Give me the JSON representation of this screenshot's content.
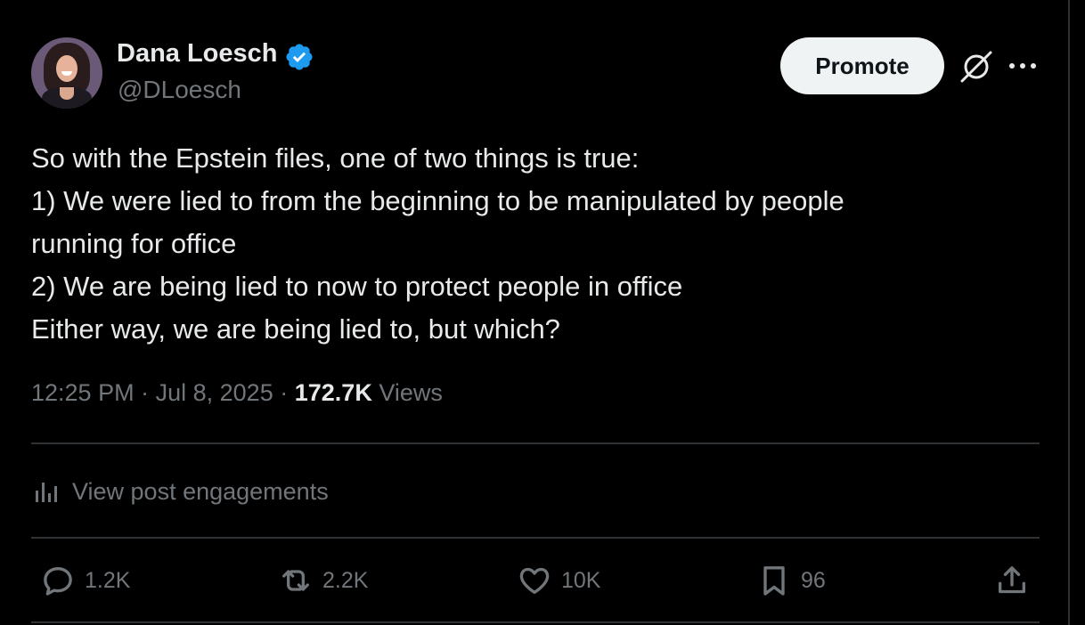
{
  "author": {
    "display_name": "Dana Loesch",
    "handle": "@DLoesch",
    "verified": true,
    "verified_color": "#1d9bf0"
  },
  "header": {
    "promote_label": "Promote",
    "grok_icon": "grok-icon",
    "more_icon": "more-icon"
  },
  "tweet": {
    "lines": [
      "So with the Epstein files, one of two things is true:",
      "1) We were lied to from the beginning to be manipulated by people",
      "running for office",
      "2) We are being lied to now to protect people in office",
      "Either way, we are being lied to, but which?"
    ]
  },
  "meta": {
    "time": "12:25 PM",
    "separator": "·",
    "date": "Jul 8, 2025",
    "views_count": "172.7K",
    "views_label": "Views"
  },
  "engagements": {
    "label": "View post engagements",
    "icon": "bar-chart-icon"
  },
  "actions": {
    "replies": "1.2K",
    "reposts": "2.2K",
    "likes": "10K",
    "bookmarks": "96"
  },
  "colors": {
    "background": "#000000",
    "text": "#e7e9ea",
    "secondary_text": "#71767b",
    "divider": "#2f3336",
    "button_bg": "#eff3f4"
  }
}
